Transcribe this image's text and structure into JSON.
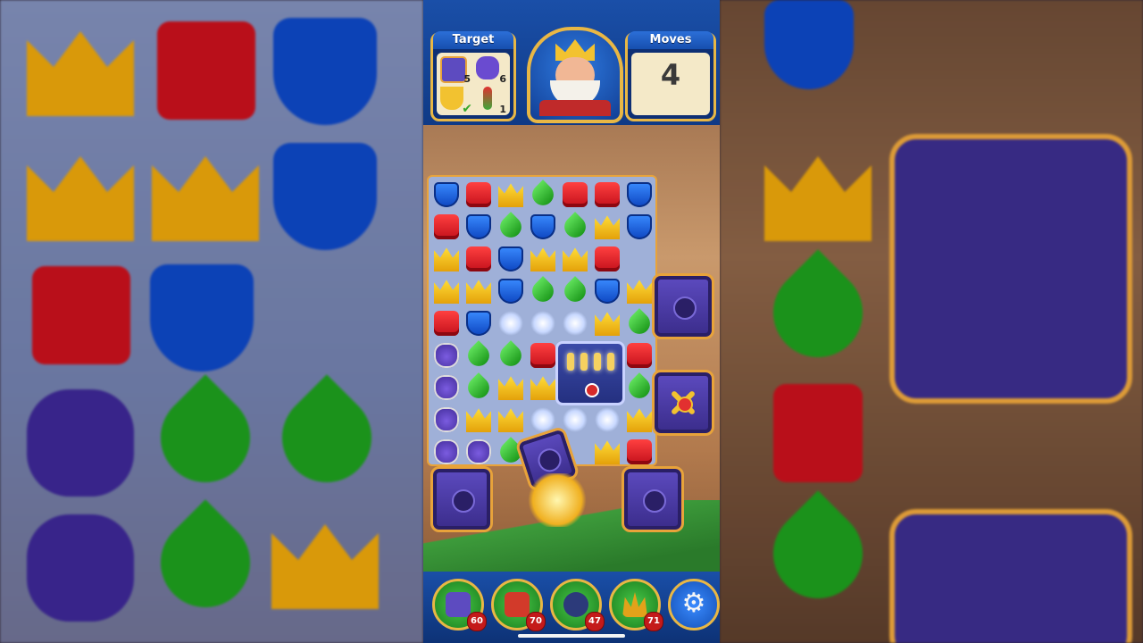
{
  "hud": {
    "target_label": "Target",
    "moves_label": "Moves",
    "moves_value": "4",
    "targets": [
      {
        "icon": "safe-box-icon",
        "count": "5",
        "color": "#5d4bc0"
      },
      {
        "icon": "vase-icon",
        "count": "6",
        "color": "#6a4bd0"
      },
      {
        "icon": "teacup-icon",
        "count": "",
        "done": true,
        "color": "#f2c230"
      },
      {
        "icon": "candle-icon",
        "count": "1",
        "color": "#3ca83a"
      }
    ]
  },
  "boosters": [
    {
      "name": "hammer-booster",
      "count": "60",
      "color": "#5d4bc0"
    },
    {
      "name": "arrow-booster",
      "count": "70",
      "color": "#d23a2a"
    },
    {
      "name": "cannon-booster",
      "count": "47",
      "color": "#2c3a7a"
    },
    {
      "name": "jester-booster",
      "count": "71",
      "color": "#e2a21a"
    }
  ],
  "settings_icon": "gear-icon",
  "board": {
    "rows": [
      [
        "blue",
        "red",
        "crown",
        "leaf",
        "red",
        "red",
        "blue"
      ],
      [
        "red",
        "blue",
        "leaf",
        "blue",
        "leaf",
        "crown",
        "blue"
      ],
      [
        "crown",
        "red",
        "blue",
        "crown",
        "crown",
        "red",
        ""
      ],
      [
        "crown",
        "crown",
        "blue",
        "leaf",
        "leaf",
        "blue",
        "crown"
      ],
      [
        "red",
        "blue",
        "sparkle",
        "sparkle",
        "sparkle",
        "crown",
        "leaf"
      ],
      [
        "vase",
        "leaf",
        "leaf",
        "red",
        "",
        "",
        "red"
      ],
      [
        "vase",
        "leaf",
        "crown",
        "crown",
        "",
        "",
        "leaf"
      ],
      [
        "vase",
        "crown",
        "crown",
        "sparkle",
        "sparkle",
        "sparkle",
        "crown"
      ],
      [
        "vase",
        "vase",
        "leaf",
        "",
        "",
        "crown",
        "red"
      ]
    ]
  }
}
